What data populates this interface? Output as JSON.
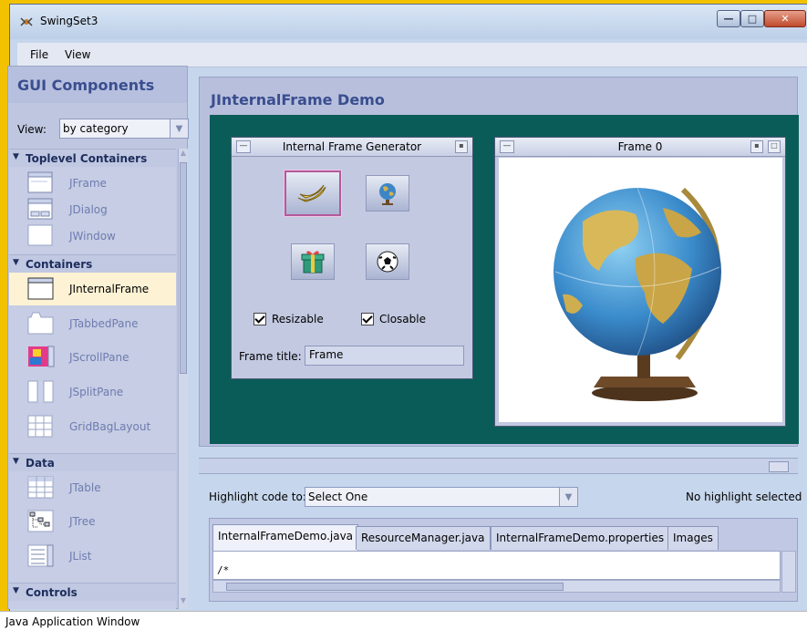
{
  "window": {
    "title": "SwingSet3",
    "minimize_icon": "minimize-icon",
    "maximize_icon": "maximize-icon",
    "close_icon": "close-icon"
  },
  "menubar": {
    "items": [
      {
        "label": "File"
      },
      {
        "label": "View"
      }
    ]
  },
  "sidebar": {
    "title": "GUI Components",
    "view_label": "View:",
    "view_value": "by category",
    "categories": [
      {
        "label": "Toplevel Containers",
        "items": [
          {
            "label": "JFrame",
            "icon": "jframe-icon"
          },
          {
            "label": "JDialog",
            "icon": "jdialog-icon"
          },
          {
            "label": "JWindow",
            "icon": "jwindow-icon"
          }
        ]
      },
      {
        "label": "Containers",
        "items": [
          {
            "label": "JInternalFrame",
            "icon": "jinternalframe-icon",
            "selected": true
          },
          {
            "label": "JTabbedPane",
            "icon": "jtabbedpane-icon"
          },
          {
            "label": "JScrollPane",
            "icon": "jscrollpane-icon"
          },
          {
            "label": "JSplitPane",
            "icon": "jsplitpane-icon"
          },
          {
            "label": "GridBagLayout",
            "icon": "gridbaglayout-icon"
          }
        ]
      },
      {
        "label": "Data",
        "items": [
          {
            "label": "JTable",
            "icon": "jtable-icon"
          },
          {
            "label": "JTree",
            "icon": "jtree-icon"
          },
          {
            "label": "JList",
            "icon": "jlist-icon"
          }
        ]
      },
      {
        "label": "Controls",
        "items": []
      }
    ]
  },
  "demo": {
    "title": "JInternalFrame Demo",
    "generator": {
      "title": "Internal Frame Generator",
      "buttons": [
        {
          "icon": "banana-icon"
        },
        {
          "icon": "globe-icon"
        },
        {
          "icon": "gift-icon"
        },
        {
          "icon": "soccer-ball-icon"
        }
      ],
      "resizable_label": "Resizable",
      "closable_label": "Closable",
      "frame_title_label": "Frame title:",
      "frame_title_value": "Frame"
    },
    "frame0": {
      "title": "Frame 0",
      "image": "globe-icon"
    }
  },
  "code": {
    "highlight_label": "Highlight code to:",
    "highlight_value": "Select One",
    "highlight_status": "No highlight selected",
    "tabs": [
      {
        "label": "InternalFrameDemo.java"
      },
      {
        "label": "ResourceManager.java"
      },
      {
        "label": "InternalFrameDemo.properties"
      },
      {
        "label": "Images"
      }
    ],
    "content": "/*"
  },
  "statusbar": {
    "text": "Java Application Window"
  },
  "colors": {
    "desktop": "#0a5c58",
    "title_blue": "#3a4e8e",
    "selected_item": "#fdf2d4",
    "taskbar_accent": "#f2c200"
  }
}
